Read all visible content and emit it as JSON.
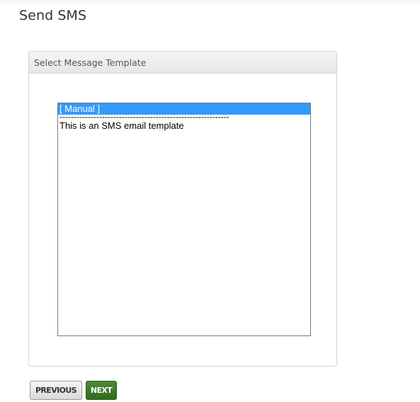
{
  "page": {
    "title": "Send SMS"
  },
  "panel": {
    "title": "Select Message Template"
  },
  "template_list": {
    "options": [
      {
        "label": "[ Manual ]",
        "selected": true
      },
      {
        "label": "------------------------------------------------------------",
        "selected": false
      },
      {
        "label": "This is an SMS email template",
        "selected": false
      }
    ]
  },
  "buttons": {
    "previous_label": "PREVIOUS",
    "next_label": "NEXT"
  },
  "colors": {
    "selection": "#3399ff",
    "next_button": "#3a7a28",
    "title_text": "#333333"
  }
}
